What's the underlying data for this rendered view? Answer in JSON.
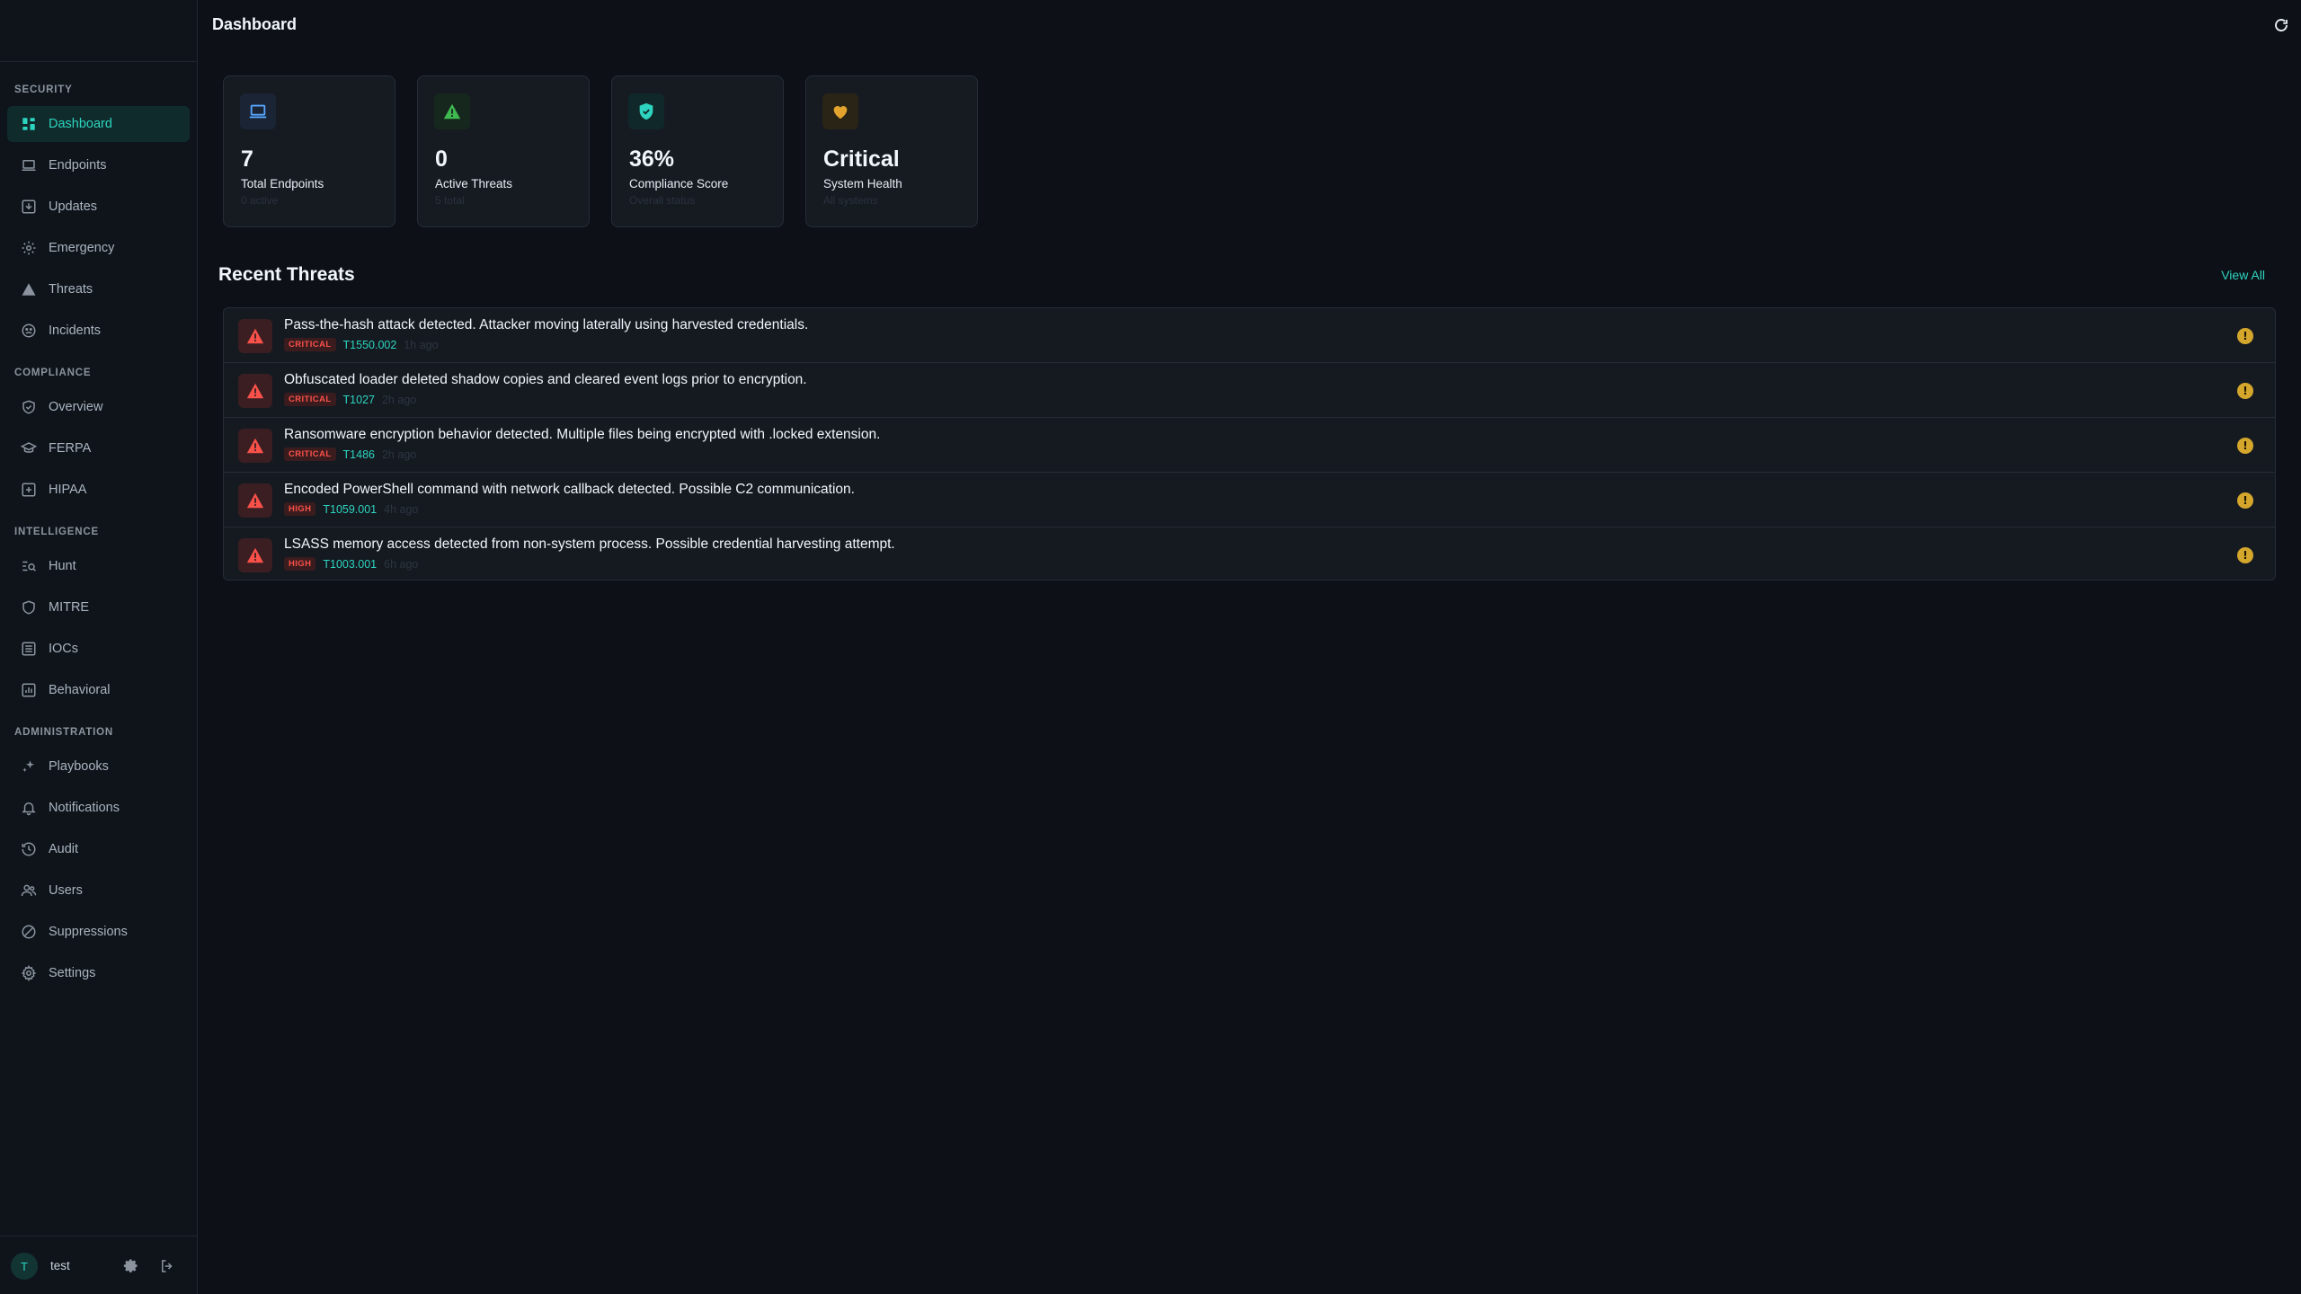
{
  "app": {
    "page_title": "Dashboard"
  },
  "sidebar": {
    "sections": [
      {
        "title": "SECURITY"
      },
      {
        "title": "COMPLIANCE"
      },
      {
        "title": "INTELLIGENCE"
      },
      {
        "title": "ADMINISTRATION"
      }
    ],
    "items": [
      {
        "label": "Dashboard",
        "icon": "grid-icon",
        "active": true
      },
      {
        "label": "Endpoints",
        "icon": "laptop-icon"
      },
      {
        "label": "Updates",
        "icon": "download-box-icon"
      },
      {
        "label": "Emergency",
        "icon": "gear-alert-icon"
      },
      {
        "label": "Threats",
        "icon": "warning-triangle-icon"
      },
      {
        "label": "Incidents",
        "icon": "incident-icon"
      },
      {
        "label": "Overview",
        "icon": "shield-check-icon"
      },
      {
        "label": "FERPA",
        "icon": "graduation-cap-icon"
      },
      {
        "label": "HIPAA",
        "icon": "medical-plus-icon"
      },
      {
        "label": "Hunt",
        "icon": "search-list-icon"
      },
      {
        "label": "MITRE",
        "icon": "shield-icon"
      },
      {
        "label": "IOCs",
        "icon": "list-icon"
      },
      {
        "label": "Behavioral",
        "icon": "chart-icon"
      },
      {
        "label": "Playbooks",
        "icon": "sparkles-icon"
      },
      {
        "label": "Notifications",
        "icon": "bell-icon"
      },
      {
        "label": "Audit",
        "icon": "history-icon"
      },
      {
        "label": "Users",
        "icon": "users-icon"
      },
      {
        "label": "Suppressions",
        "icon": "slash-circle-icon"
      },
      {
        "label": "Settings",
        "icon": "gear-icon"
      }
    ],
    "user": {
      "initial": "T",
      "name": "test"
    }
  },
  "stats": [
    {
      "value": "7",
      "label": "Total Endpoints",
      "sub": "0 active",
      "icon": "laptop-icon",
      "color": "#58a6ff"
    },
    {
      "value": "0",
      "label": "Active Threats",
      "sub": "5 total",
      "icon": "warning-triangle-icon",
      "color": "#3fb950"
    },
    {
      "value": "36%",
      "label": "Compliance Score",
      "sub": "Overall status",
      "icon": "shield-check-icon",
      "color": "#2dd4bf"
    },
    {
      "value": "Critical",
      "label": "System Health",
      "sub": "All systems",
      "icon": "heart-icon",
      "color": "#e3a32d"
    }
  ],
  "recent_threats": {
    "title": "Recent Threats",
    "view_all": "View All",
    "items": [
      {
        "title": "Pass-the-hash attack detected. Attacker moving laterally using harvested credentials.",
        "severity": "CRITICAL",
        "technique": "T1550.002",
        "time": "1h ago"
      },
      {
        "title": "Obfuscated loader deleted shadow copies and cleared event logs prior to encryption.",
        "severity": "CRITICAL",
        "technique": "T1027",
        "time": "2h ago"
      },
      {
        "title": "Ransomware encryption behavior detected. Multiple files being encrypted with .locked extension.",
        "severity": "CRITICAL",
        "technique": "T1486",
        "time": "2h ago"
      },
      {
        "title": "Encoded PowerShell command with network callback detected. Possible C2 communication.",
        "severity": "HIGH",
        "technique": "T1059.001",
        "time": "4h ago"
      },
      {
        "title": "LSASS memory access detected from non-system process. Possible credential harvesting attempt.",
        "severity": "HIGH",
        "technique": "T1003.001",
        "time": "6h ago"
      }
    ]
  }
}
